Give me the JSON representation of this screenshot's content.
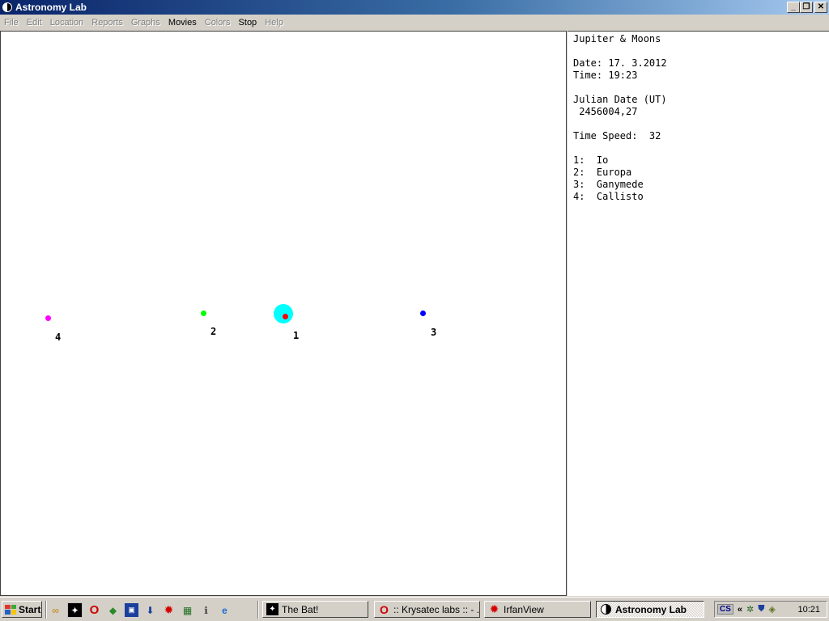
{
  "window": {
    "title": "Astronomy Lab"
  },
  "menu": [
    {
      "label": "File",
      "enabled": false
    },
    {
      "label": "Edit",
      "enabled": false
    },
    {
      "label": "Location",
      "enabled": false
    },
    {
      "label": "Reports",
      "enabled": false
    },
    {
      "label": "Graphs",
      "enabled": false
    },
    {
      "label": "Movies",
      "enabled": true
    },
    {
      "label": "Colors",
      "enabled": false
    },
    {
      "label": "Stop",
      "enabled": true
    },
    {
      "label": "Help",
      "enabled": false
    }
  ],
  "info": {
    "heading": "Jupiter & Moons",
    "date": "Date: 17. 3.2012",
    "time": "Time: 19:23",
    "julian_label": "Julian Date (UT)",
    "julian_value": " 2456004,27",
    "time_speed": "Time Speed:  32",
    "moons": [
      "1:  Io",
      "2:  Europa",
      "3:  Ganymede",
      "4:  Callisto"
    ]
  },
  "plot": {
    "jupiter_color": "#00ffff",
    "labels": {
      "io": "1",
      "europa": "2",
      "ganymede": "3",
      "callisto": "4"
    },
    "colors": {
      "io": "#ff0000",
      "europa": "#00ff00",
      "ganymede": "#0000ff",
      "callisto": "#ff00ff"
    }
  },
  "taskbar": {
    "start_label": "Start",
    "tasks": [
      {
        "label": "The Bat!",
        "icon": "bat-icon"
      },
      {
        "label": ":: Krysatec labs :: - ...",
        "icon": "opera-icon"
      },
      {
        "label": "IrfanView",
        "icon": "irfanview-icon"
      },
      {
        "label": "Astronomy Lab",
        "icon": "astronomy-lab-icon"
      }
    ],
    "language": "CS",
    "clock": "10:21"
  }
}
